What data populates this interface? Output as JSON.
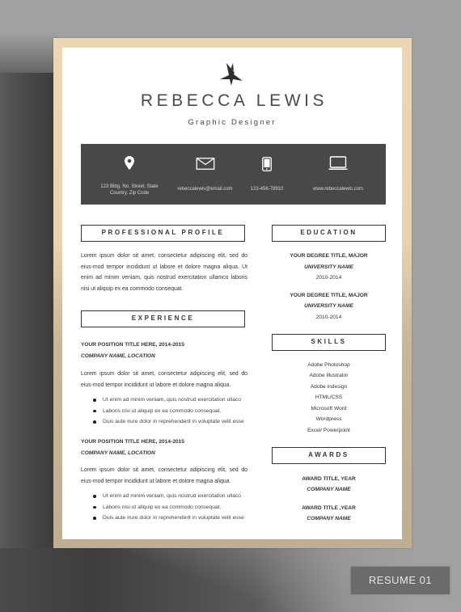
{
  "header": {
    "name": "REBECCA LEWIS",
    "title": "Graphic Designer",
    "logo_icon": "abstract-bird-logo"
  },
  "contact": [
    {
      "icon": "location-pin-icon",
      "text_line1": "123 Bldg. No. Street, State",
      "text_line2": "Country, Zip Code"
    },
    {
      "icon": "envelope-icon",
      "text_line1": "rebeccalewis@email.com",
      "text_line2": ""
    },
    {
      "icon": "mobile-phone-icon",
      "text_line1": "123-456-78910",
      "text_line2": ""
    },
    {
      "icon": "laptop-icon",
      "text_line1": "www.rebeccalewis.com",
      "text_line2": ""
    }
  ],
  "profile": {
    "heading": "PROFESSIONAL PROFILE",
    "text": "Lorem ipsum dolor sit amet, consectetur adipiscing elit, sed do eius-mod tempor incididunt ut labore et dolore magna aliqua. Ut enim ad minim veniam, quis nostrud exercitation ullamco laboris nisi ut aliquip ex ea commodo consequat."
  },
  "experience": {
    "heading": "EXPERIENCE",
    "jobs": [
      {
        "title": "YOUR POSITION TITLE HERE, 2014-2015",
        "company": "COMPANY NAME, LOCATION",
        "description": "Lorem ipsum dolor sit amet, consectetur adipiscing elit, sed do eius-mod tempor incididunt ut labore et dolore magna aliqua.",
        "bullets": [
          "Ut enim ad minim veniam, quis nostrud exercitation ullaco",
          "Laboris nisi ut aliquip ex ea commodo consequat.",
          "Duis aute irure dolor in reprehenderit in voluptate velit esse"
        ]
      },
      {
        "title": "YOUR POSITION TITLE HERE, 2014-2015",
        "company": "COMPANY NAME, LOCATION",
        "description": "Lorem ipsum dolor sit amet, consectetur adipiscing elit, sed do eius-mod tempor incididunt ut labore et dolore magna aliqua.",
        "bullets": [
          "Ut enim ad minim veniam, quis nostrud exercitation ullaco",
          "Laboris nisi ut aliquip ex ea commodo consequat.",
          "Duis aute irure dolor in reprehenderit in voluptate velit esse"
        ]
      }
    ]
  },
  "education": {
    "heading": "EDUCATION",
    "entries": [
      {
        "degree": "YOUR DEGREE TITLE, MAJOR",
        "university": "UNIVERSITY NAME",
        "years": "2010-2014"
      },
      {
        "degree": "YOUR DEGREE TITLE, MAJOR",
        "university": "UNIVERSITY NAME",
        "years": "2010-2014"
      }
    ]
  },
  "skills": {
    "heading": "SKILLS",
    "items": [
      "Adobe Photoshop",
      "Adobe Illustrator",
      "Adobe indesign",
      "HTML/CSS",
      "Microsoft Word",
      "Wordpress",
      "Excel/ Powerpoint"
    ]
  },
  "awards": {
    "heading": "AWARDS",
    "entries": [
      {
        "title": "AWARD TITLE, YEAR",
        "company": "COMPANY NAME"
      },
      {
        "title": "AWARD TITLE ,YEAR",
        "company": "COMPANY NAME"
      }
    ]
  },
  "badge": {
    "label": "RESUME 01"
  },
  "colors": {
    "background": "#a1a1a1",
    "frame_gold": "#ecd6b4",
    "contact_band": "#484848",
    "text": "#333333"
  }
}
